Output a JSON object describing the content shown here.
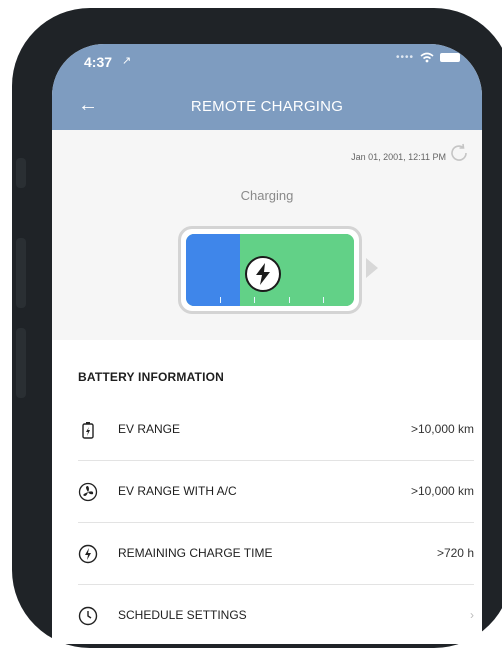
{
  "status_bar": {
    "time": "4:37",
    "location_glyph": "↗"
  },
  "header": {
    "back_glyph": "←",
    "title": "REMOTE CHARGING"
  },
  "charging": {
    "timestamp": "Jan 01, 2001, 12:11 PM",
    "state": "Charging",
    "level_fraction": 0.32
  },
  "battery_info": {
    "title": "BATTERY INFORMATION",
    "rows": [
      {
        "icon": "ev-battery-icon",
        "label": "EV RANGE",
        "value": ">10,000 km"
      },
      {
        "icon": "fan-icon",
        "label": "EV RANGE WITH A/C",
        "value": ">10,000 km"
      },
      {
        "icon": "charge-time-icon",
        "label": "REMAINING CHARGE TIME",
        "value": ">720 h"
      },
      {
        "icon": "schedule-icon",
        "label": "SCHEDULE SETTINGS",
        "value": ""
      }
    ]
  },
  "colors": {
    "header": "#7e9cc0",
    "battery_blue": "#3f86ea",
    "battery_green": "#62d187"
  }
}
